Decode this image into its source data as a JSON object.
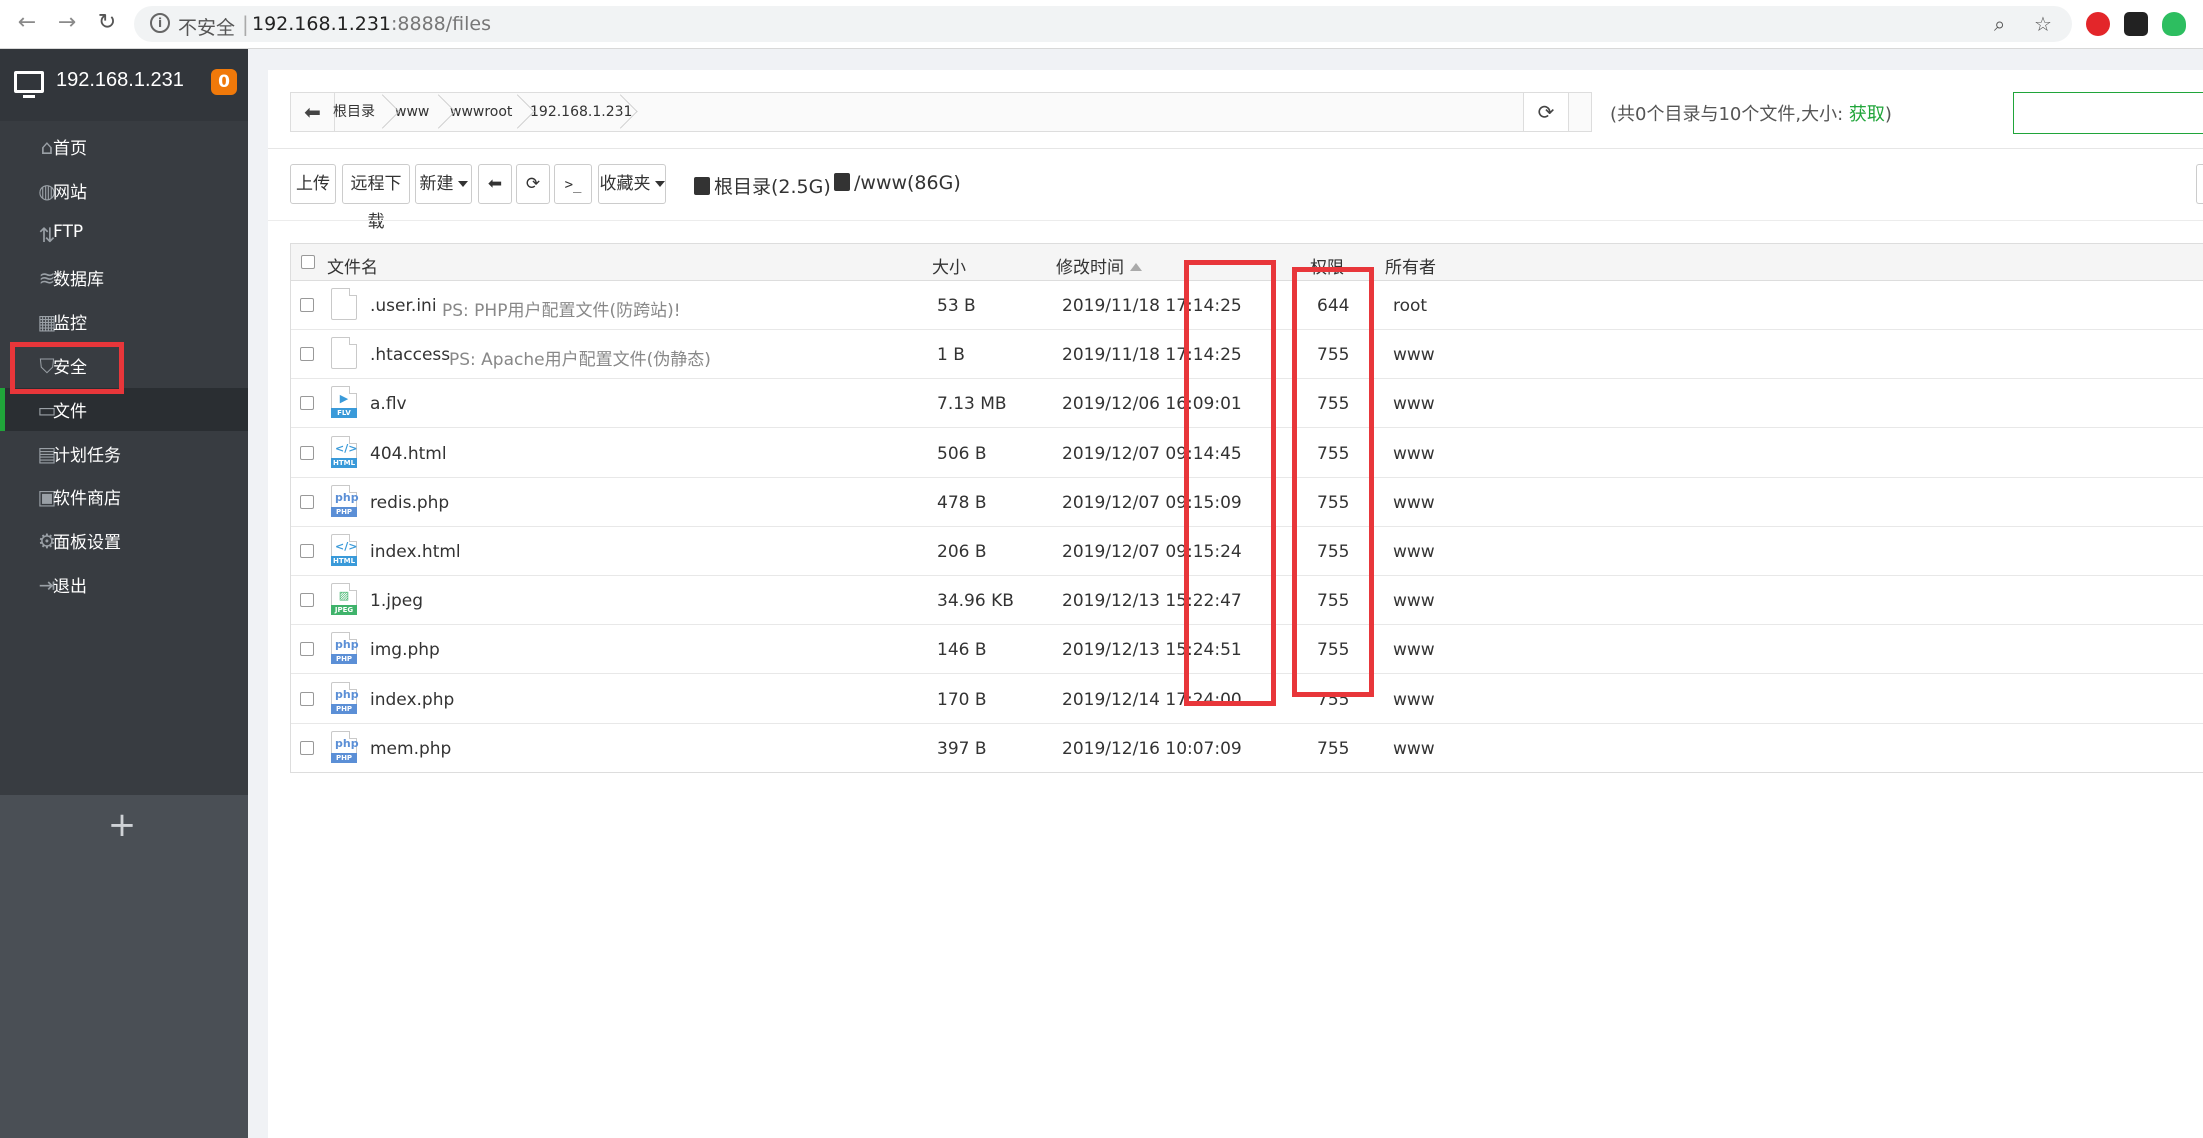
{
  "browser": {
    "insecure_label": "不安全",
    "host": "192.168.1.231",
    "path": ":8888/files"
  },
  "sidebar": {
    "title": "192.168.1.231",
    "badge": "0",
    "items": [
      {
        "label": "首页",
        "icon": "home-icon"
      },
      {
        "label": "网站",
        "icon": "globe-icon"
      },
      {
        "label": "FTP",
        "icon": "ftp-icon"
      },
      {
        "label": "数据库",
        "icon": "database-icon"
      },
      {
        "label": "监控",
        "icon": "monitor-icon"
      },
      {
        "label": "安全",
        "icon": "shield-icon"
      },
      {
        "label": "文件",
        "icon": "folder-icon"
      },
      {
        "label": "计划任务",
        "icon": "calendar-icon"
      },
      {
        "label": "软件商店",
        "icon": "grid-icon"
      },
      {
        "label": "面板设置",
        "icon": "gear-icon"
      },
      {
        "label": "退出",
        "icon": "logout-icon"
      }
    ],
    "active_index": 6
  },
  "breadcrumb": [
    "根目录",
    "www",
    "wwwroot",
    "192.168.1.231"
  ],
  "dir_info": {
    "text": "(共0个目录与10个文件,大小: ",
    "link": "获取",
    "suffix": ")"
  },
  "toolbar": {
    "upload": "上传",
    "remote_download": "远程下载",
    "new": "新建",
    "favorites": "收藏夹",
    "disks": [
      "根目录(2.5G)",
      "/www(86G)"
    ]
  },
  "table": {
    "headers": {
      "name": "文件名",
      "size": "大小",
      "mtime": "修改时间",
      "perm": "权限",
      "owner": "所有者"
    },
    "rows": [
      {
        "name": ".user.ini",
        "note": "PS: PHP用户配置文件(防跨站)!",
        "size": "53 B",
        "mtime": "2019/11/18 17:14:25",
        "perm": "644",
        "owner": "root",
        "type": "blank"
      },
      {
        "name": ".htaccess",
        "note": "PS: Apache用户配置文件(伪静态)",
        "size": "1 B",
        "mtime": "2019/11/18 17:14:25",
        "perm": "755",
        "owner": "www",
        "type": "blank"
      },
      {
        "name": "a.flv",
        "note": "",
        "size": "7.13 MB",
        "mtime": "2019/12/06 16:09:01",
        "perm": "755",
        "owner": "www",
        "type": "FLV"
      },
      {
        "name": "404.html",
        "note": "",
        "size": "506 B",
        "mtime": "2019/12/07 09:14:45",
        "perm": "755",
        "owner": "www",
        "type": "HTML"
      },
      {
        "name": "redis.php",
        "note": "",
        "size": "478 B",
        "mtime": "2019/12/07 09:15:09",
        "perm": "755",
        "owner": "www",
        "type": "PHP"
      },
      {
        "name": "index.html",
        "note": "",
        "size": "206 B",
        "mtime": "2019/12/07 09:15:24",
        "perm": "755",
        "owner": "www",
        "type": "HTML"
      },
      {
        "name": "1.jpeg",
        "note": "",
        "size": "34.96 KB",
        "mtime": "2019/12/13 15:22:47",
        "perm": "755",
        "owner": "www",
        "type": "JPEG"
      },
      {
        "name": "img.php",
        "note": "",
        "size": "146 B",
        "mtime": "2019/12/13 15:24:51",
        "perm": "755",
        "owner": "www",
        "type": "PHP"
      },
      {
        "name": "index.php",
        "note": "",
        "size": "170 B",
        "mtime": "2019/12/14 17:24:00",
        "perm": "755",
        "owner": "www",
        "type": "PHP"
      },
      {
        "name": "mem.php",
        "note": "",
        "size": "397 B",
        "mtime": "2019/12/16 10:07:09",
        "perm": "755",
        "owner": "www",
        "type": "PHP"
      }
    ]
  },
  "colors": {
    "accent": "#20a53a",
    "highlight": "#e8363a",
    "badge": "#f0790a",
    "php": "#5b8fd6",
    "html": "#3a9ad9",
    "flv": "#3a9ad9",
    "jpeg": "#3fb36b"
  }
}
